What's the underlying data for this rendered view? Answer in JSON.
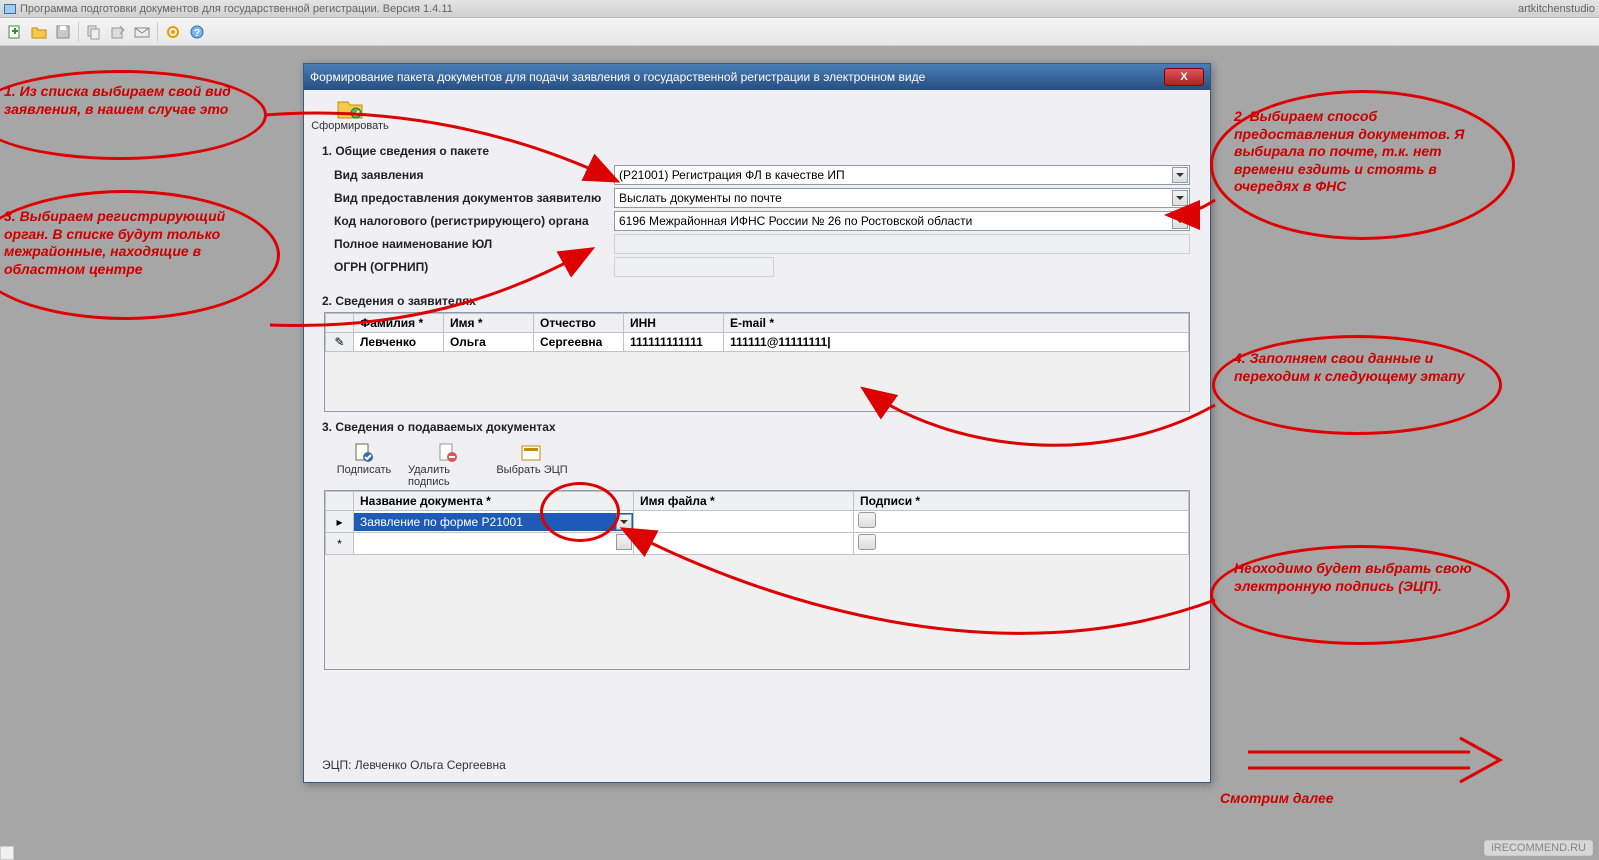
{
  "app": {
    "title": "Программа подготовки документов для государственной регистрации. Версия 1.4.11",
    "watermark_right": "artkitchenstudio"
  },
  "toolbar": {
    "icons": [
      "new-doc-icon",
      "open-folder-icon",
      "save-icon",
      "copy-icon",
      "export-icon",
      "mail-icon",
      "settings-gear-icon",
      "help-icon"
    ]
  },
  "dialog": {
    "title": "Формирование пакета документов для подачи заявления о государственной регистрации в электронном виде",
    "form_button": "Сформировать",
    "section1": {
      "title": "1. Общие сведения о пакете",
      "row1_label": "Вид заявления",
      "row1_value": "(Р21001) Регистрация ФЛ в качестве ИП",
      "row2_label": "Вид предоставления документов заявителю",
      "row2_value": "Выслать документы по почте",
      "row3_label": "Код налогового (регистрирующего) органа",
      "row3_value": "6196 Межрайонная ИФНС России № 26 по Ростовской области",
      "row4_label": "Полное наименование ЮЛ",
      "row5_label": "ОГРН (ОГРНИП)"
    },
    "section2": {
      "title": "2. Сведения о заявителях",
      "cols": {
        "c1": "Фамилия *",
        "c2": "Имя *",
        "c3": "Отчество",
        "c4": "ИНН",
        "c5": "E-mail *"
      },
      "row": {
        "surname": "Левченко",
        "name": "Ольга",
        "patronymic": "Сергеевна",
        "inn": "111111111111",
        "email": "111111@11111111|"
      }
    },
    "section3": {
      "title": "3. Сведения о подаваемых документах",
      "btn_sign": "Подписать",
      "btn_del": "Удалить подпись",
      "btn_choose": "Выбрать ЭЦП",
      "cols": {
        "c1": "Название документа *",
        "c2": "Имя файла *",
        "c3": "Подписи *"
      },
      "row": {
        "docname": "Заявление по форме Р21001"
      }
    },
    "status": "ЭЦП: Левченко Ольга Сергеевна"
  },
  "annotations": {
    "a1": "1. Из списка выбираем свой вид заявления, в нашем случае это",
    "a2": "2. Выбираем способ предоставления документов. Я выбирала по почте, т.к. нет времени ездить и стоять в очередях в ФНС",
    "a3": "3. Выбираем регистрирующий орган. В списке будут только межрайонные, находящие в областном центре",
    "a4": "4. Заполняем свои данные и переходим к следующему этапу",
    "a5": "Неоходимо будет выбрать свою электронную подпись (ЭЦП).",
    "a6": "Смотрим далее"
  },
  "footer_watermark": "iRECOMMEND.RU"
}
